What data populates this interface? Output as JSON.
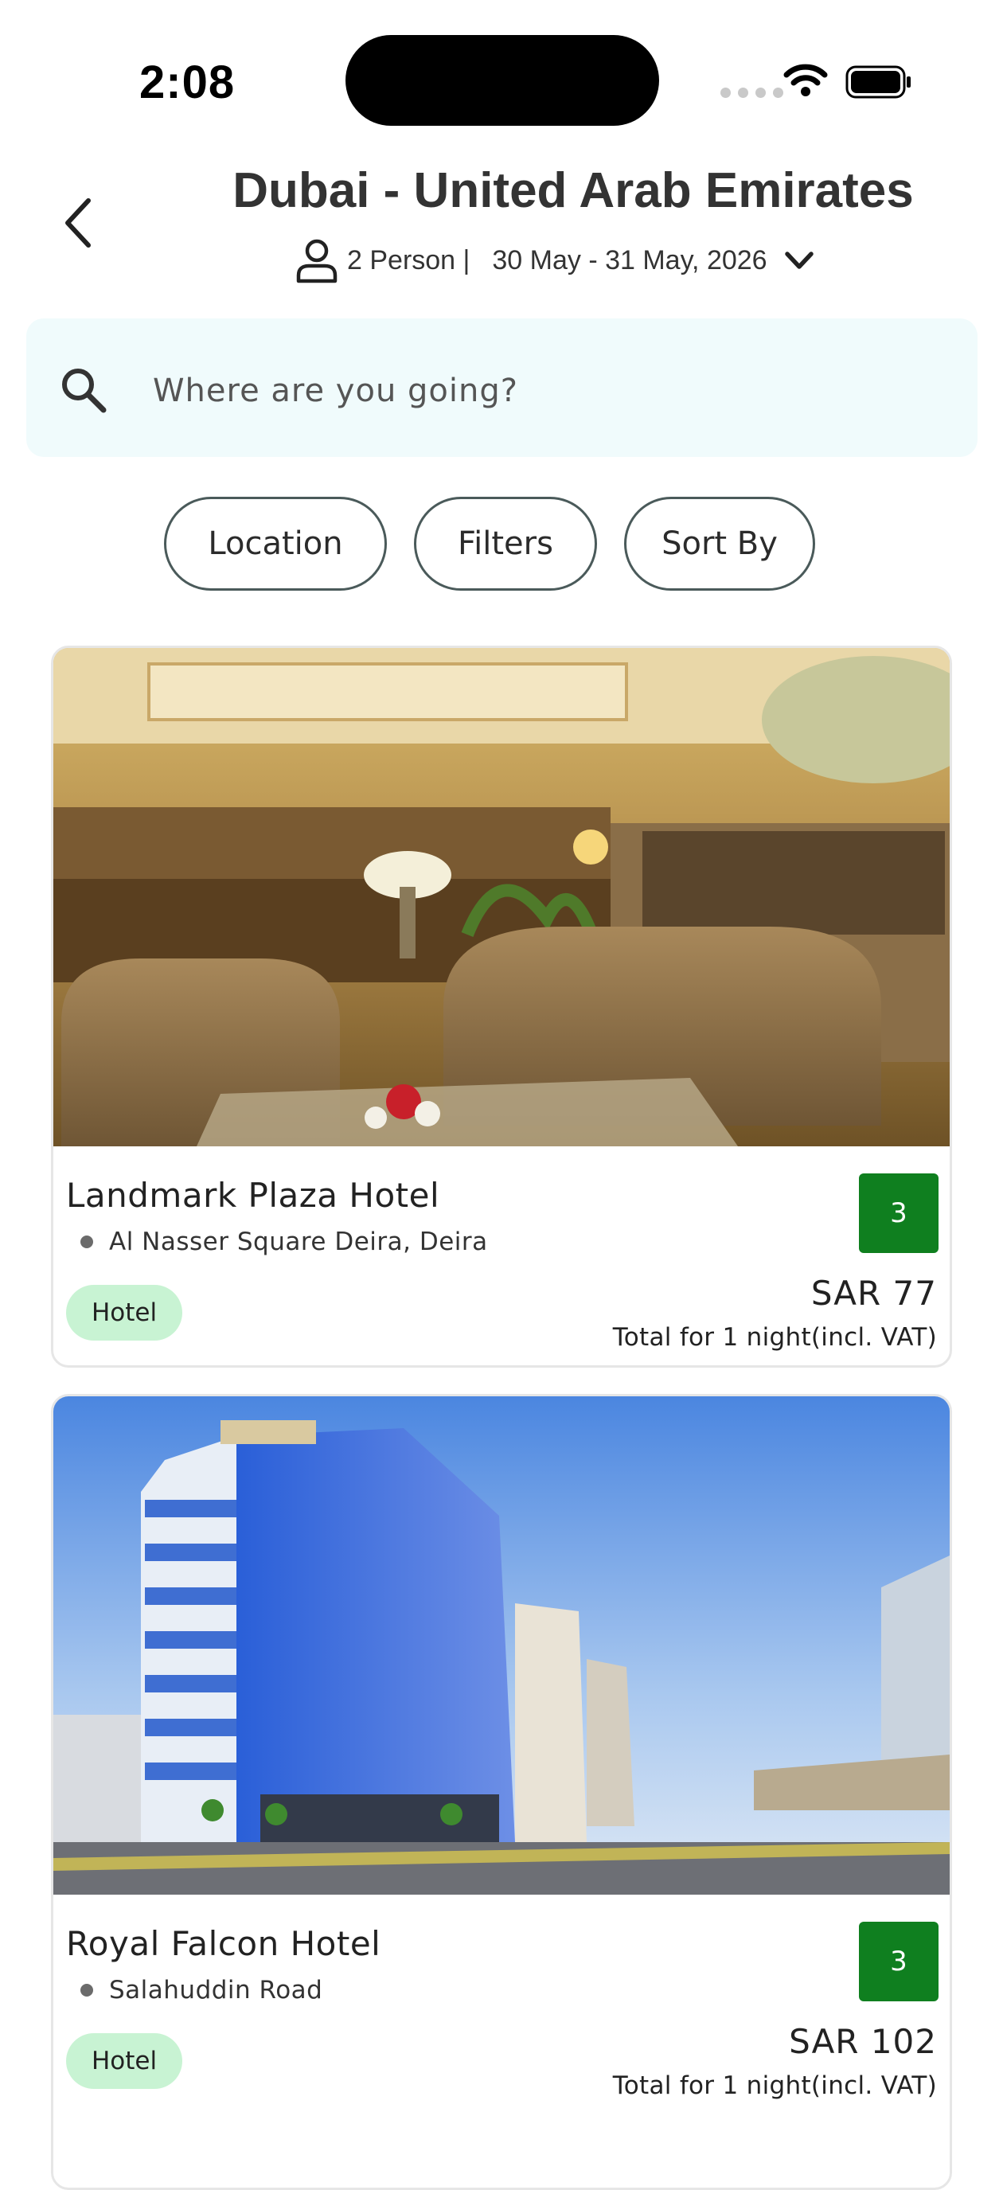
{
  "status_bar": {
    "time": "2:08"
  },
  "header": {
    "title": "Dubai - United Arab Emirates",
    "guests": "2 Person |",
    "dates": "30 May - 31 May, 2026"
  },
  "search": {
    "placeholder": "Where are you going?"
  },
  "filters": {
    "location": "Location",
    "filters": "Filters",
    "sort_by": "Sort By"
  },
  "hotels": [
    {
      "name": "Landmark Plaza Hotel",
      "address": "Al Nasser Square Deira, Deira",
      "stars": "3",
      "type": "Hotel",
      "price": "SAR 77",
      "price_note": "Total for 1 night(incl. VAT)"
    },
    {
      "name": "Royal Falcon Hotel",
      "address": "Salahuddin Road",
      "stars": "3",
      "type": "Hotel",
      "price": "SAR 102",
      "price_note": "Total for 1 night(incl. VAT)"
    }
  ],
  "colors": {
    "search_bg": "#f0fbfc",
    "star_badge": "#0f7f1f",
    "type_badge": "#c8f3d3"
  }
}
